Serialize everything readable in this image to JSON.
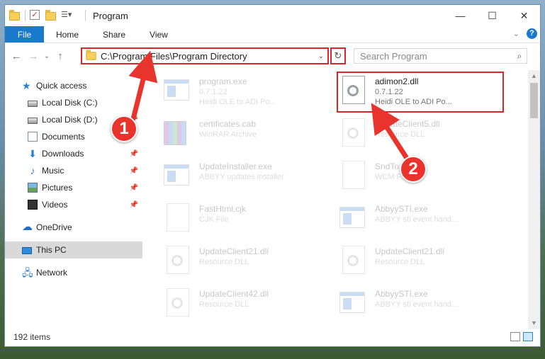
{
  "window": {
    "title": "Program",
    "controls": {
      "minimize": "—",
      "maximize": "☐",
      "close": "✕"
    }
  },
  "ribbon": {
    "tabs": [
      "File",
      "Home",
      "Share",
      "View"
    ],
    "help": "?"
  },
  "nav": {
    "back": "←",
    "forward": "→",
    "recent": "⌄",
    "up": "↑"
  },
  "address": {
    "path": "C:\\Program Files\\Program Directory",
    "dropdown": "⌄",
    "refresh": "↻"
  },
  "search": {
    "placeholder": "Search Program",
    "icon": "⌕"
  },
  "sidebar": {
    "items": [
      {
        "label": "Quick access",
        "icon": "star-icon"
      },
      {
        "label": "Local Disk (C:)",
        "icon": "disk-icon"
      },
      {
        "label": "Local Disk (D:)",
        "icon": "disk-icon"
      },
      {
        "label": "Documents",
        "icon": "document-icon"
      },
      {
        "label": "Downloads",
        "icon": "download-icon"
      },
      {
        "label": "Music",
        "icon": "music-icon"
      },
      {
        "label": "Pictures",
        "icon": "pictures-icon"
      },
      {
        "label": "Videos",
        "icon": "videos-icon"
      },
      {
        "label": "OneDrive",
        "icon": "cloud-icon"
      },
      {
        "label": "This PC",
        "icon": "pc-icon"
      },
      {
        "label": "Network",
        "icon": "network-icon"
      }
    ]
  },
  "files": [
    {
      "name": "program.exe",
      "line1": "0.7.1.22",
      "line2": "Heidi OLE to ADI Po...",
      "icon": "exe-icon"
    },
    {
      "name": "adimon2.dll",
      "line1": "0.7.1.22",
      "line2": "Heidi OLE to ADI Po...",
      "icon": "dll-icon"
    },
    {
      "name": "certificates.cab",
      "line1": "WinRAR Archive",
      "line2": "",
      "icon": "archive-icon"
    },
    {
      "name": "UpdateClient5.dll",
      "line1": "Resource DLL",
      "line2": "",
      "icon": "dll-icon"
    },
    {
      "name": "UpdateInstaller.exe",
      "line1": "ABBYY updates installer",
      "line2": "",
      "icon": "exe-icon"
    },
    {
      "name": "SndTo...wcm",
      "line1": "WCM F...",
      "line2": "",
      "icon": "file-icon"
    },
    {
      "name": "FastHtml.cjk",
      "line1": "CJK File",
      "line2": "",
      "icon": "file-icon"
    },
    {
      "name": "AbbyySTI.exe",
      "line1": "ABBYY sti event hand...",
      "line2": "",
      "icon": "exe-icon"
    },
    {
      "name": "UpdateClient21.dll",
      "line1": "Resource DLL",
      "line2": "",
      "icon": "dll-icon"
    },
    {
      "name": "UpdateClient21.dll",
      "line1": "Resource DLL",
      "line2": "",
      "icon": "dll-icon"
    },
    {
      "name": "UpdateClient42.dll",
      "line1": "Resource DLL",
      "line2": "",
      "icon": "dll-icon"
    },
    {
      "name": "AbbyySTI.exe",
      "line1": "ABBYY sti event hand...",
      "line2": "",
      "icon": "exe-icon"
    }
  ],
  "status": {
    "count": "192 items"
  },
  "annotations": {
    "step1": "1",
    "step2": "2",
    "color": "#e8342c"
  }
}
